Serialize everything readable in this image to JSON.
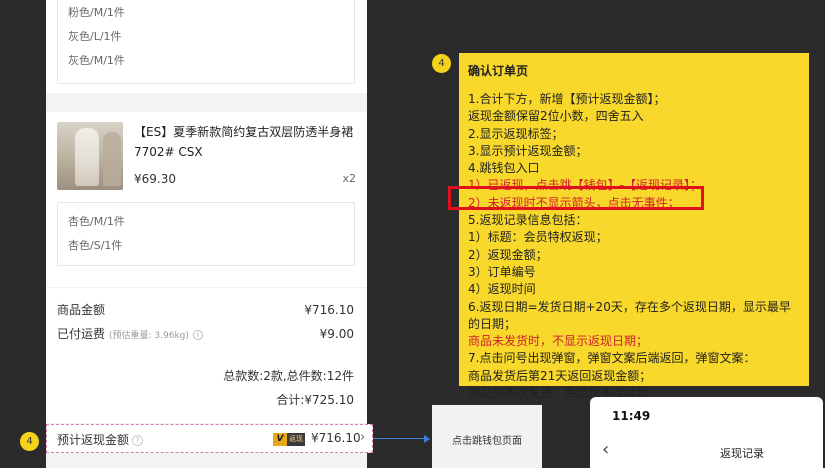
{
  "phone": {
    "variants_top": [
      "粉色/M/1件",
      "灰色/L/1件",
      "灰色/M/1件"
    ],
    "product": {
      "title": "【ES】夏季新款简约复古双层防透半身裙7702#  CSX",
      "price": "¥69.30",
      "qty": "x2"
    },
    "variants_bottom": [
      "杏色/M/1件",
      "杏色/S/1件"
    ],
    "summary": {
      "goods_label": "商品金额",
      "goods_value": "¥716.10",
      "shipping_label": "已付运费",
      "shipping_weight": "(预估重量: 3.96kg)",
      "shipping_value": "¥9.00",
      "totals": "总款数:2款,总件数:12件",
      "total": "合计:¥725.10"
    },
    "rebate": {
      "label": "预计返现金额",
      "tag_v": "V",
      "tag_text": "返现",
      "amount": "¥716.10",
      "chevron": "›"
    }
  },
  "badges": {
    "left": "4",
    "top": "4"
  },
  "jump_box": {
    "text": "点击跳钱包页面"
  },
  "note": {
    "title": "确认订单页",
    "lines": [
      {
        "text": "1.合计下方，新增【预计返现金额】；",
        "red": false
      },
      {
        "text": "返现金额保留2位小数，四舍五入",
        "red": false
      },
      {
        "text": "2.显示返现标签；",
        "red": false
      },
      {
        "text": "3.显示预计返现金额；",
        "red": false
      },
      {
        "text": "4.跳钱包入口",
        "red": false
      },
      {
        "text": "1）已返现，点击跳【钱包】-【返现记录】；",
        "red": true
      },
      {
        "text": "2）未返现时不显示箭头，点击无事件；",
        "red": true
      },
      {
        "text": "5.返现记录信息包括：",
        "red": false
      },
      {
        "text": "1）标题：会员特权返现；",
        "red": false
      },
      {
        "text": "2）返现金额；",
        "red": false
      },
      {
        "text": "3）订单编号",
        "red": false
      },
      {
        "text": "4）返现时间",
        "red": false
      },
      {
        "text": "6.返现日期=发货日期+20天，存在多个返现日期，显示最早的日期；",
        "red": false
      },
      {
        "text": "商品未发货时，不显示返现日期；",
        "red": true
      },
      {
        "text": "7.点击问号出现弹窗，弹窗文案后端返回，弹窗文案：",
        "red": false
      },
      {
        "text": "商品发货后第21天返回返现金额；",
        "red": false
      },
      {
        "text": "商品分多次发货，会出现多次返现",
        "red": false
      }
    ]
  },
  "mini_phone": {
    "time": "11:49",
    "back": "‹",
    "title": "返现记录"
  },
  "colors": {
    "note_bg": "#f8d82a",
    "red": "#d0202e",
    "highlight": "#e0101c",
    "arrow": "#3b7fd9",
    "dash": "#d67ab3"
  }
}
